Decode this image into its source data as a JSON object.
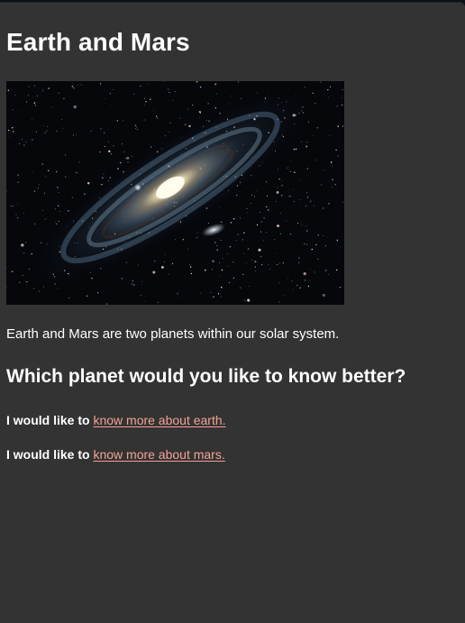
{
  "page": {
    "title": "Earth and Mars",
    "intro": "Earth and Mars are two planets within our solar system.",
    "question": "Which planet would you like to know better?",
    "image_icon": "galaxy-image",
    "choices": [
      {
        "lead": "I would like to",
        "link_text": "know more about earth."
      },
      {
        "lead": "I would like to",
        "link_text": "know more about mars."
      }
    ]
  },
  "colors": {
    "background": "#333333",
    "text": "#ffffff",
    "link": "#f4a193"
  }
}
